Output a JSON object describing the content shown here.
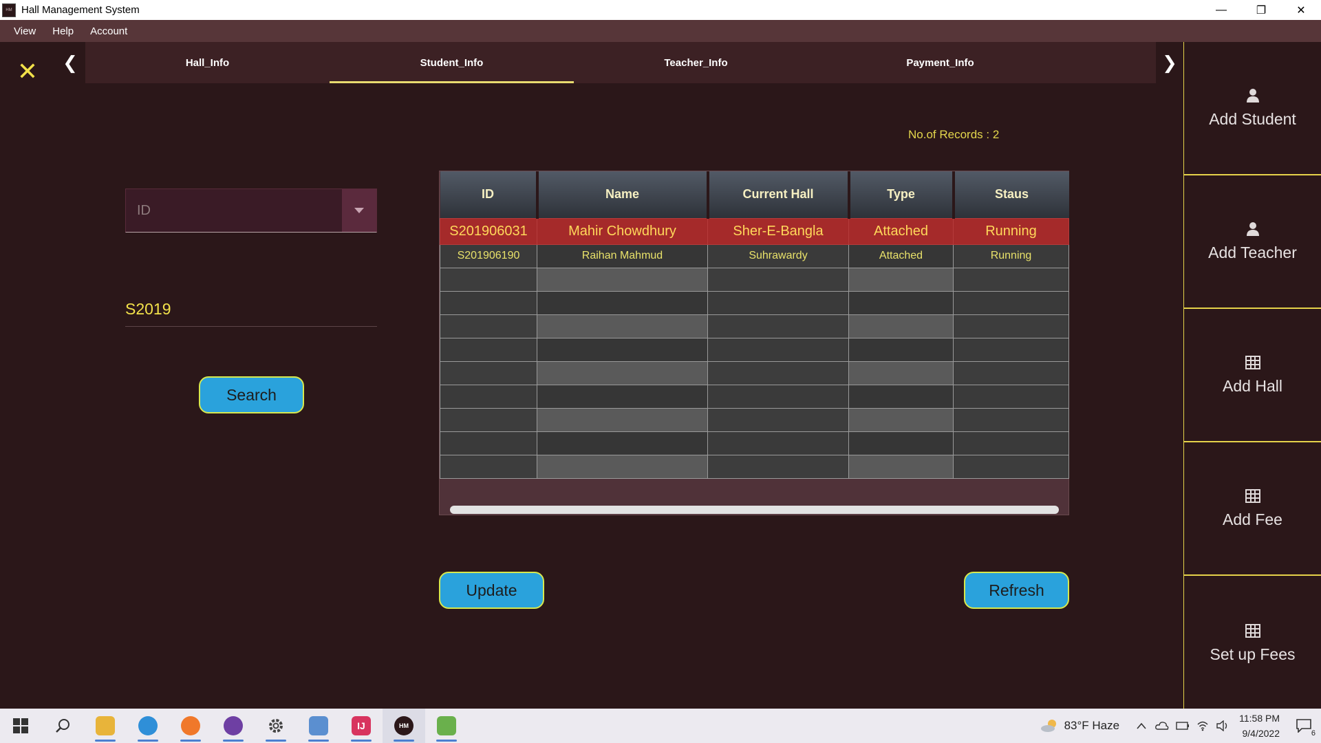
{
  "window": {
    "title": "Hall Management System",
    "app_icon_text": "HM",
    "minimize": "—",
    "restore": "❐",
    "close": "✕"
  },
  "menu": [
    "View",
    "Help",
    "Account"
  ],
  "header": {
    "close_glyph": "✕",
    "prev_glyph": "❮",
    "next_glyph": "❯"
  },
  "tabs": [
    "Hall_Info",
    "Student_Info",
    "Teacher_Info",
    "Payment_Info"
  ],
  "active_tab": "Student_Info",
  "sidebar": [
    "Add Student",
    "Add Teacher",
    "Add Hall",
    "Add Fee",
    "Set up Fees"
  ],
  "records_label": "No.of Records : 2",
  "search": {
    "combo_value": "ID",
    "query": "S2019",
    "button": "Search"
  },
  "table": {
    "columns": [
      "ID",
      "Name",
      "Current Hall",
      "Type",
      "Staus"
    ],
    "rows": [
      [
        "S201906031",
        "Mahir Chowdhury",
        "Sher-E-Bangla",
        "Attached",
        "Running"
      ],
      [
        "S201906190",
        "Raihan Mahmud",
        "Suhrawardy",
        "Attached",
        "Running"
      ]
    ]
  },
  "actions": {
    "update": "Update",
    "refresh": "Refresh"
  },
  "taskbar": {
    "weather": "83°F  Haze",
    "time": "11:58 PM",
    "date": "9/4/2022",
    "notifications": "6",
    "jetbrains_label": "IJ",
    "app_label": "HM"
  },
  "colors": {
    "accent_yellow": "#f2e14a",
    "button_blue": "#2aa2dc",
    "selected_row": "#a52a2a",
    "background": "#2b1719"
  }
}
